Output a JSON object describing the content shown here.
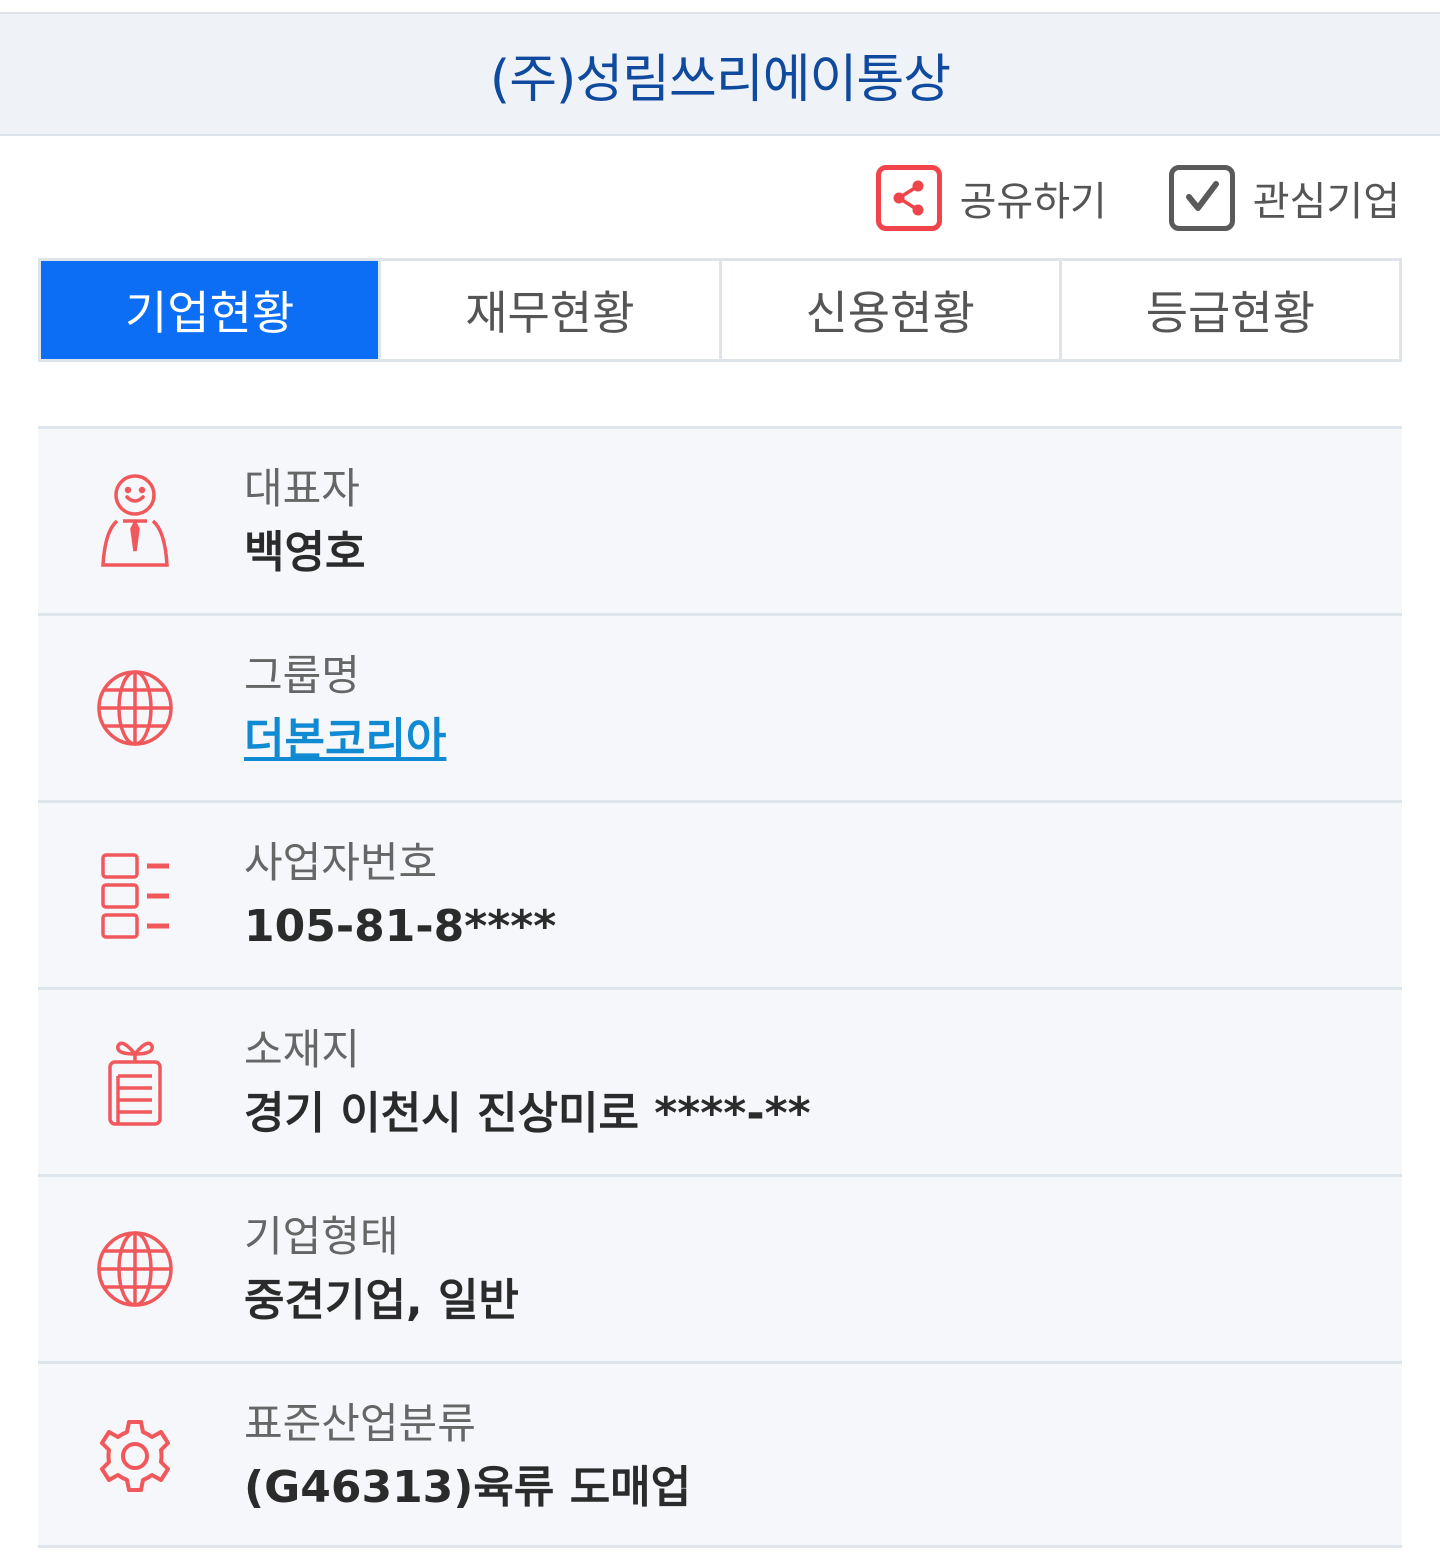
{
  "header": {
    "title": "(주)성림쓰리에이통상"
  },
  "actions": {
    "share_label": "공유하기",
    "favorite_label": "관심기업"
  },
  "tabs": [
    {
      "label": "기업현황",
      "active": true
    },
    {
      "label": "재무현황",
      "active": false
    },
    {
      "label": "신용현황",
      "active": false
    },
    {
      "label": "등급현황",
      "active": false
    }
  ],
  "info": [
    {
      "icon": "person-tie-icon",
      "label": "대표자",
      "value": "백영호"
    },
    {
      "icon": "globe-icon",
      "label": "그룹명",
      "value": "더본코리아"
    },
    {
      "icon": "list-icon",
      "label": "사업자번호",
      "value": "105-81-8****"
    },
    {
      "icon": "building-icon",
      "label": "소재지",
      "value": "경기 이천시 진상미로 ****-**"
    },
    {
      "icon": "globe-icon",
      "label": "기업형태",
      "value": "중견기업, 일반"
    },
    {
      "icon": "gear-icon",
      "label": "표준산업분류",
      "value": "(G46313)육류 도매업"
    }
  ],
  "colors": {
    "header_text": "#104a9e",
    "active_tab": "#0b6ef5",
    "icon_red": "#f0585c",
    "link": "#0f8ad3"
  }
}
